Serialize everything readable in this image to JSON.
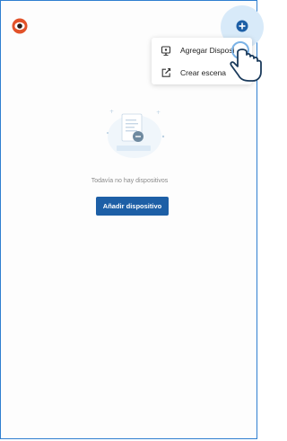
{
  "header": {
    "logo_icon": "eye-logo-icon",
    "add_icon": "plus-circle-icon",
    "accent_color": "#1d5fa6"
  },
  "menu": {
    "items": [
      {
        "label": "Agregar Disposi",
        "icon": "device-add-icon"
      },
      {
        "label": "Crear escena",
        "icon": "scene-edit-icon"
      }
    ]
  },
  "empty_state": {
    "illustration": "empty-document-illustration",
    "message": "Todavía no hay dispositivos",
    "button_label": "Añadir dispositivo"
  },
  "pointer": {
    "icon": "hand-pointer-icon"
  }
}
